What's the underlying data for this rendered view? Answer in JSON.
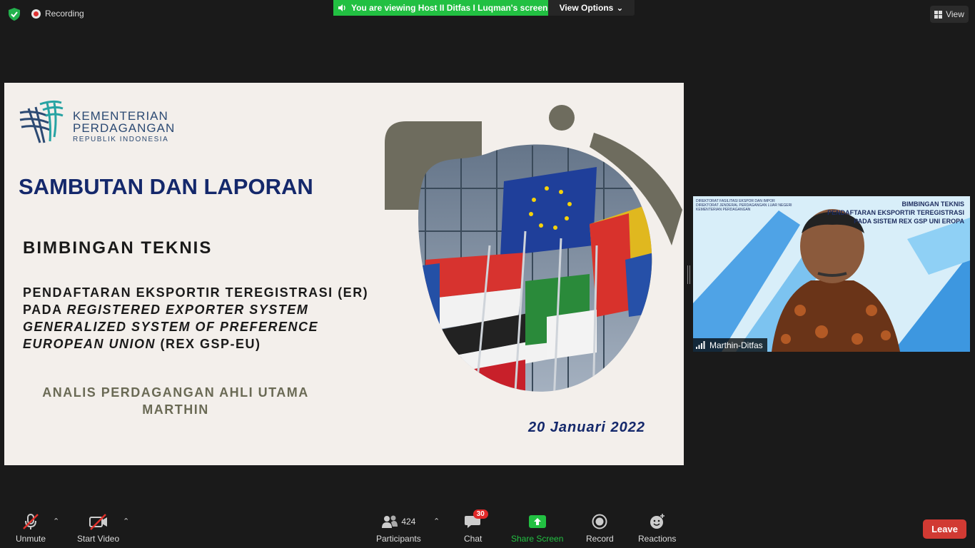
{
  "topbar": {
    "recording_label": "Recording",
    "banner_text": "You are viewing Host II Ditfas I Luqman's screen",
    "view_options_label": "View Options",
    "view_label": "View"
  },
  "slide": {
    "logo_line1": "KEMENTERIAN",
    "logo_line2": "PERDAGANGAN",
    "logo_line3": "REPUBLIK INDONESIA",
    "title": "SAMBUTAN DAN LAPORAN",
    "subtitle": "BIMBINGAN TEKNIS",
    "body_line1": "PENDAFTARAN EKSPORTIR TEREGISTRASI (ER)",
    "body_line2_plain": "PADA ",
    "body_line2_italic": "REGISTERED EXPORTER SYSTEM",
    "body_line3_italic": "GENERALIZED SYSTEM OF PREFERENCE",
    "body_line4_italic": "EUROPEAN UNION",
    "body_line4_plain": " (REX GSP-EU)",
    "role_line1": "ANALIS PERDAGANGAN AHLI UTAMA",
    "role_line2": "MARTHIN",
    "date": "20 Januari 2022"
  },
  "participant": {
    "name": "Marthin-Ditfas",
    "bg_title_line1": "BIMBINGAN TEKNIS",
    "bg_title_line2": "PENDAFTARAN EKSPORTIR TEREGISTRASI",
    "bg_title_line3": "PADA SISTEM REX GSP UNI EROPA",
    "bg_logo_line1": "DIREKTORAT FASILITASI EKSPOR DAN IMPOR",
    "bg_logo_line2": "DIREKTORAT JENDERAL PERDAGANGAN LUAR NEGERI",
    "bg_logo_line3": "KEMENTERIAN PERDAGANGAN"
  },
  "toolbar": {
    "unmute_label": "Unmute",
    "start_video_label": "Start Video",
    "participants_label": "Participants",
    "participants_count": "424",
    "chat_label": "Chat",
    "chat_badge": "30",
    "share_label": "Share Screen",
    "record_label": "Record",
    "reactions_label": "Reactions",
    "leave_label": "Leave"
  },
  "colors": {
    "banner_green": "#22c042",
    "leave_red": "#d13a33",
    "slide_title_blue": "#14286b",
    "shape_olive": "#6e6c5e"
  }
}
